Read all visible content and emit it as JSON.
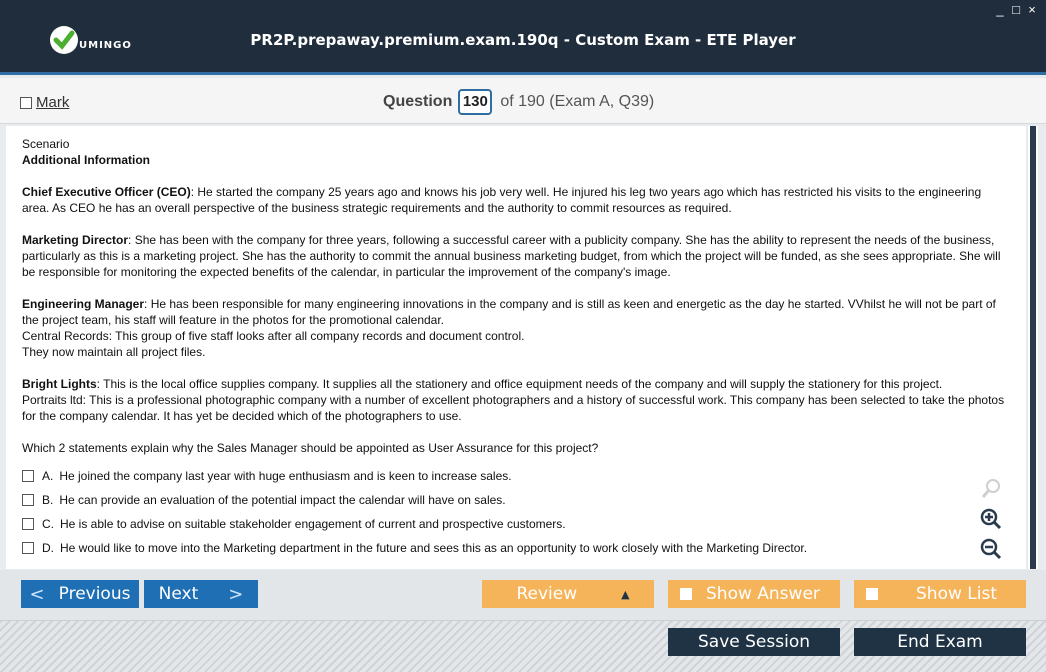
{
  "window": {
    "title": "PR2P.prepaway.premium.exam.190q - Custom Exam - ETE Player",
    "logo_text": "UMINGO",
    "controls": [
      "_",
      "□",
      "×"
    ]
  },
  "question_bar": {
    "mark_label": "Mark",
    "question_label": "Question",
    "question_number": "130",
    "of_text": "of 190 (Exam A, Q39)"
  },
  "content": {
    "scenario": "Scenario",
    "heading": "Additional Information",
    "paragraphs": [
      {
        "bold": "Chief Executive Officer (CEO)",
        "text": ": He started the company 25 years ago and knows his job very well. He injured his leg two years ago which has restricted his visits to the engineering area. As CEO he has an overall perspective of the business strategic requirements and the authority to commit resources as required."
      },
      {
        "bold": "Marketing Director",
        "text": ": She has been with the company for three years, following a successful career with a publicity company. She has the ability to represent the needs of the business, particularly as this is a marketing project. She has the authority to commit the annual business marketing budget, from which the project will be funded, as she sees appropriate. She will be responsible for monitoring the expected benefits of the calendar, in particular the improvement of the company's image."
      },
      {
        "bold": "Engineering Manager",
        "text": ": He has been responsible for many engineering innovations in the company and is still as keen and energetic as the day he started. VVhilst he will not be part of the project team, his staff will feature in the photos for the promotional calendar."
      },
      {
        "bold": "Bright Lights",
        "text": ": This is the local office supplies company. It supplies all the stationery and office equipment needs of the company and will supply the stationery for this project."
      }
    ],
    "central_records_1": "Central Records: This group of five staff looks after all company records and document control.",
    "central_records_2": "They now maintain all project files.",
    "portraits": "Portraits ltd: This is a professional photographic company with a number of excellent photographers and a history of successful work. This company has been selected to take the photos for the company calendar. It has yet be decided which of the photographers to use.",
    "question": "Which 2 statements explain why the Sales Manager should be appointed as User Assurance for this project?",
    "answers": [
      {
        "letter": "A.",
        "text": "He joined the company last year with huge enthusiasm and is keen to increase sales."
      },
      {
        "letter": "B.",
        "text": "He can provide an evaluation of the potential impact the calendar will have on sales."
      },
      {
        "letter": "C.",
        "text": "He is able to advise on suitable stakeholder engagement of current and prospective customers."
      },
      {
        "letter": "D.",
        "text": "He would like to move into the Marketing department in the future and sees this as an opportunity to work closely with the Marketing Director."
      }
    ]
  },
  "nav": {
    "previous": "Previous",
    "next": "Next",
    "review": "Review",
    "show_answer": "Show Answer",
    "show_list": "Show List",
    "save_session": "Save Session",
    "end_exam": "End Exam"
  },
  "colors": {
    "titlebar": "#1f2d3d",
    "accent_blue": "#1f6fb4",
    "accent_orange": "#f6b45a",
    "dark_button": "#1f3345"
  }
}
